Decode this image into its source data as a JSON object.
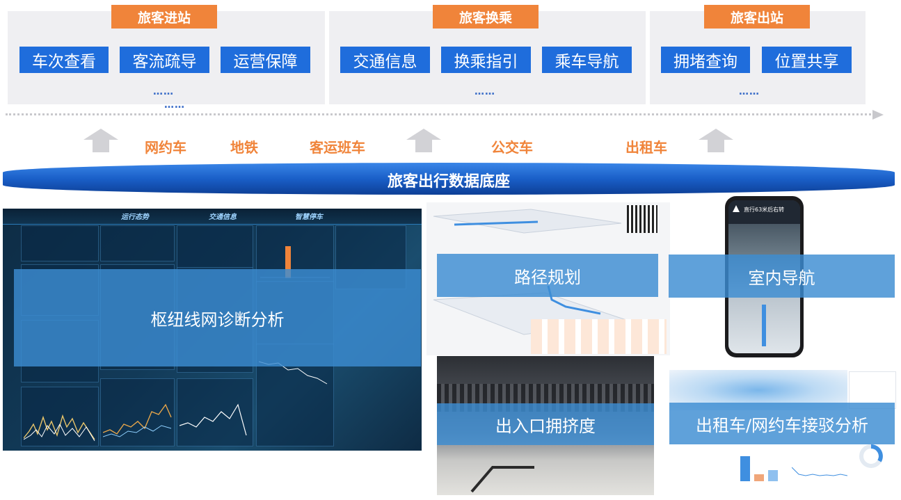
{
  "stages": [
    {
      "tag": "旅客进站",
      "buttons": [
        "车次查看",
        "客流疏导",
        "运营保障"
      ],
      "more": "……",
      "more2": "……"
    },
    {
      "tag": "旅客换乘",
      "buttons": [
        "交通信息",
        "换乘指引",
        "乘车导航"
      ],
      "more": "……"
    },
    {
      "tag": "旅客出站",
      "buttons": [
        "拥堵查询",
        "位置共享"
      ],
      "more": "……"
    }
  ],
  "modes": [
    "网约车",
    "地铁",
    "客运班车",
    "公交车",
    "出租车"
  ],
  "banner": "旅客出行数据底座",
  "dashboard": {
    "tabs": [
      "运行态势",
      "交通信息",
      "智慧停车"
    ],
    "overlay": "枢纽线网诊断分析"
  },
  "panels": {
    "route": "路径规划",
    "indoor": "室内导航",
    "crowd": "出入口拥挤度",
    "taxi": "出租车/网约车接驳分析"
  },
  "phone": {
    "instruction": "直行63米后右转"
  },
  "colors": {
    "accent_orange": "#f0843a",
    "button_blue": "#1f6ddc",
    "banner_blue": "#1a5fc8",
    "overlay_blue": "#3c8cd2"
  }
}
